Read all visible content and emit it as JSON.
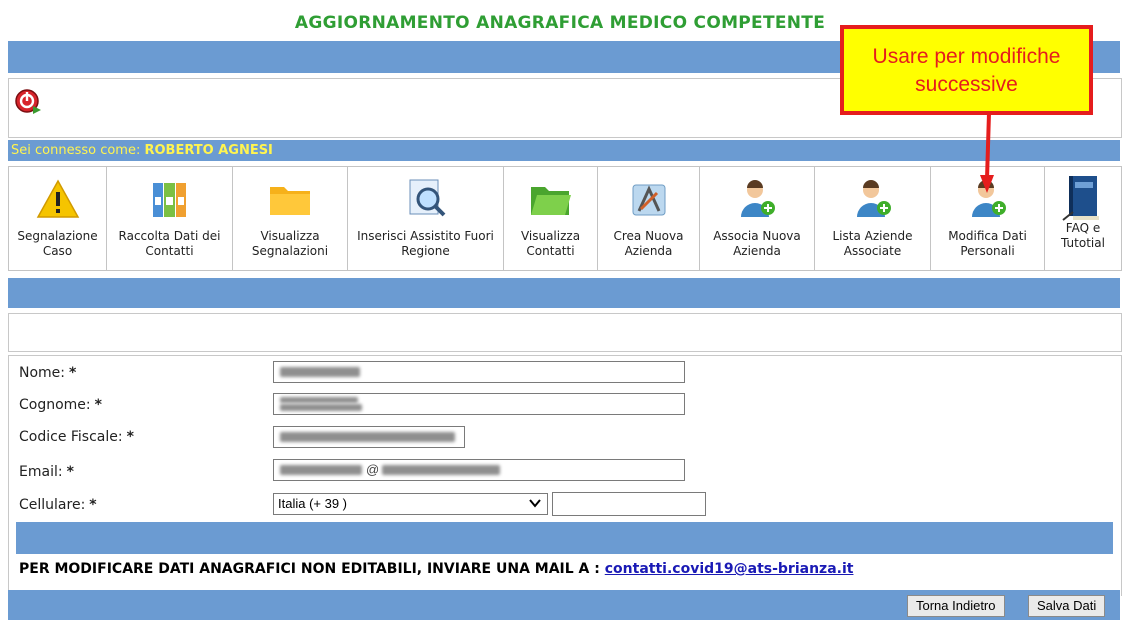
{
  "page": {
    "title": "AGGIORNAMENTO ANAGRAFICA MEDICO COMPETENTE",
    "user_prefix": "Sei connesso come: ",
    "user_name": "ROBERTO AGNESI"
  },
  "menu": {
    "items": [
      {
        "label": "Segnalazione Caso",
        "icon": "warning-icon"
      },
      {
        "label": "Raccolta Dati dei Contatti",
        "icon": "binders-icon"
      },
      {
        "label": "Visualizza Segnalazioni",
        "icon": "folder-icon"
      },
      {
        "label": "Inserisci Assistito Fuori Regione",
        "icon": "magnifier-document-icon"
      },
      {
        "label": "Visualizza Contatti",
        "icon": "open-folder-icon"
      },
      {
        "label": "Crea Nuova Azienda",
        "icon": "app-builder-icon"
      },
      {
        "label": "Associa Nuova Azienda",
        "icon": "user-add-icon"
      },
      {
        "label": "Lista Aziende Associate",
        "icon": "user-add-icon"
      },
      {
        "label": "Modifica Dati Personali",
        "icon": "user-add-icon"
      },
      {
        "label": "FAQ e Tutotial",
        "icon": "book-icon"
      }
    ]
  },
  "form": {
    "nome_label": "Nome:",
    "cognome_label": "Cognome:",
    "cf_label": "Codice Fiscale:",
    "email_label": "Email:",
    "cellulare_label": "Cellulare:",
    "required_mark": "*",
    "email_visible": "@",
    "country_select": "Italia (+ 39 )",
    "phone_value": ""
  },
  "notice": {
    "text": "PER MODIFICARE DATI ANAGRAFICI NON EDITABILI, INVIARE UNA MAIL A : ",
    "email": "contatti.covid19@ats-brianza.it"
  },
  "buttons": {
    "back": "Torna Indietro",
    "save": "Salva Dati"
  },
  "annotation": {
    "callout_text": "Usare per modifiche successive"
  },
  "colors": {
    "title_green": "#2f9e34",
    "bar_blue": "#6b9bd2",
    "user_yellow": "#fff44f",
    "callout_yellow": "#ffff00",
    "callout_red": "#e51d1d"
  }
}
